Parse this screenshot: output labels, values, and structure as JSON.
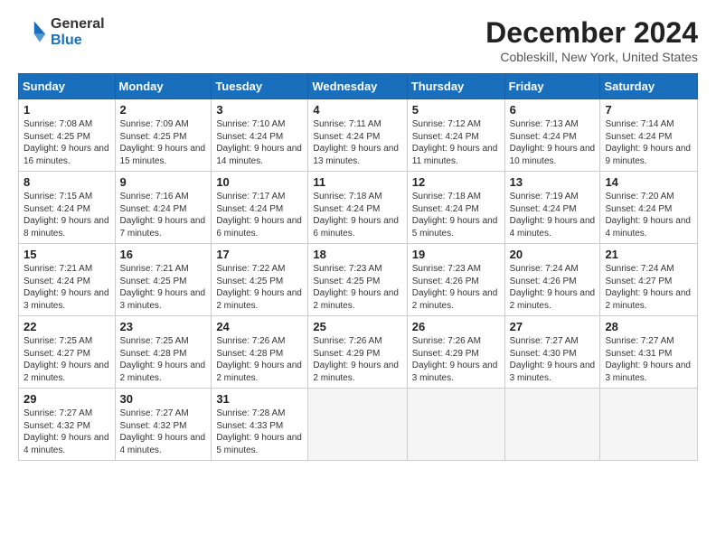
{
  "logo": {
    "general": "General",
    "blue": "Blue"
  },
  "title": "December 2024",
  "subtitle": "Cobleskill, New York, United States",
  "headers": [
    "Sunday",
    "Monday",
    "Tuesday",
    "Wednesday",
    "Thursday",
    "Friday",
    "Saturday"
  ],
  "weeks": [
    [
      {
        "day": "1",
        "sunrise": "Sunrise: 7:08 AM",
        "sunset": "Sunset: 4:25 PM",
        "daylight": "Daylight: 9 hours and 16 minutes."
      },
      {
        "day": "2",
        "sunrise": "Sunrise: 7:09 AM",
        "sunset": "Sunset: 4:25 PM",
        "daylight": "Daylight: 9 hours and 15 minutes."
      },
      {
        "day": "3",
        "sunrise": "Sunrise: 7:10 AM",
        "sunset": "Sunset: 4:24 PM",
        "daylight": "Daylight: 9 hours and 14 minutes."
      },
      {
        "day": "4",
        "sunrise": "Sunrise: 7:11 AM",
        "sunset": "Sunset: 4:24 PM",
        "daylight": "Daylight: 9 hours and 13 minutes."
      },
      {
        "day": "5",
        "sunrise": "Sunrise: 7:12 AM",
        "sunset": "Sunset: 4:24 PM",
        "daylight": "Daylight: 9 hours and 11 minutes."
      },
      {
        "day": "6",
        "sunrise": "Sunrise: 7:13 AM",
        "sunset": "Sunset: 4:24 PM",
        "daylight": "Daylight: 9 hours and 10 minutes."
      },
      {
        "day": "7",
        "sunrise": "Sunrise: 7:14 AM",
        "sunset": "Sunset: 4:24 PM",
        "daylight": "Daylight: 9 hours and 9 minutes."
      }
    ],
    [
      {
        "day": "8",
        "sunrise": "Sunrise: 7:15 AM",
        "sunset": "Sunset: 4:24 PM",
        "daylight": "Daylight: 9 hours and 8 minutes."
      },
      {
        "day": "9",
        "sunrise": "Sunrise: 7:16 AM",
        "sunset": "Sunset: 4:24 PM",
        "daylight": "Daylight: 9 hours and 7 minutes."
      },
      {
        "day": "10",
        "sunrise": "Sunrise: 7:17 AM",
        "sunset": "Sunset: 4:24 PM",
        "daylight": "Daylight: 9 hours and 6 minutes."
      },
      {
        "day": "11",
        "sunrise": "Sunrise: 7:18 AM",
        "sunset": "Sunset: 4:24 PM",
        "daylight": "Daylight: 9 hours and 6 minutes."
      },
      {
        "day": "12",
        "sunrise": "Sunrise: 7:18 AM",
        "sunset": "Sunset: 4:24 PM",
        "daylight": "Daylight: 9 hours and 5 minutes."
      },
      {
        "day": "13",
        "sunrise": "Sunrise: 7:19 AM",
        "sunset": "Sunset: 4:24 PM",
        "daylight": "Daylight: 9 hours and 4 minutes."
      },
      {
        "day": "14",
        "sunrise": "Sunrise: 7:20 AM",
        "sunset": "Sunset: 4:24 PM",
        "daylight": "Daylight: 9 hours and 4 minutes."
      }
    ],
    [
      {
        "day": "15",
        "sunrise": "Sunrise: 7:21 AM",
        "sunset": "Sunset: 4:24 PM",
        "daylight": "Daylight: 9 hours and 3 minutes."
      },
      {
        "day": "16",
        "sunrise": "Sunrise: 7:21 AM",
        "sunset": "Sunset: 4:25 PM",
        "daylight": "Daylight: 9 hours and 3 minutes."
      },
      {
        "day": "17",
        "sunrise": "Sunrise: 7:22 AM",
        "sunset": "Sunset: 4:25 PM",
        "daylight": "Daylight: 9 hours and 2 minutes."
      },
      {
        "day": "18",
        "sunrise": "Sunrise: 7:23 AM",
        "sunset": "Sunset: 4:25 PM",
        "daylight": "Daylight: 9 hours and 2 minutes."
      },
      {
        "day": "19",
        "sunrise": "Sunrise: 7:23 AM",
        "sunset": "Sunset: 4:26 PM",
        "daylight": "Daylight: 9 hours and 2 minutes."
      },
      {
        "day": "20",
        "sunrise": "Sunrise: 7:24 AM",
        "sunset": "Sunset: 4:26 PM",
        "daylight": "Daylight: 9 hours and 2 minutes."
      },
      {
        "day": "21",
        "sunrise": "Sunrise: 7:24 AM",
        "sunset": "Sunset: 4:27 PM",
        "daylight": "Daylight: 9 hours and 2 minutes."
      }
    ],
    [
      {
        "day": "22",
        "sunrise": "Sunrise: 7:25 AM",
        "sunset": "Sunset: 4:27 PM",
        "daylight": "Daylight: 9 hours and 2 minutes."
      },
      {
        "day": "23",
        "sunrise": "Sunrise: 7:25 AM",
        "sunset": "Sunset: 4:28 PM",
        "daylight": "Daylight: 9 hours and 2 minutes."
      },
      {
        "day": "24",
        "sunrise": "Sunrise: 7:26 AM",
        "sunset": "Sunset: 4:28 PM",
        "daylight": "Daylight: 9 hours and 2 minutes."
      },
      {
        "day": "25",
        "sunrise": "Sunrise: 7:26 AM",
        "sunset": "Sunset: 4:29 PM",
        "daylight": "Daylight: 9 hours and 2 minutes."
      },
      {
        "day": "26",
        "sunrise": "Sunrise: 7:26 AM",
        "sunset": "Sunset: 4:29 PM",
        "daylight": "Daylight: 9 hours and 3 minutes."
      },
      {
        "day": "27",
        "sunrise": "Sunrise: 7:27 AM",
        "sunset": "Sunset: 4:30 PM",
        "daylight": "Daylight: 9 hours and 3 minutes."
      },
      {
        "day": "28",
        "sunrise": "Sunrise: 7:27 AM",
        "sunset": "Sunset: 4:31 PM",
        "daylight": "Daylight: 9 hours and 3 minutes."
      }
    ],
    [
      {
        "day": "29",
        "sunrise": "Sunrise: 7:27 AM",
        "sunset": "Sunset: 4:32 PM",
        "daylight": "Daylight: 9 hours and 4 minutes."
      },
      {
        "day": "30",
        "sunrise": "Sunrise: 7:27 AM",
        "sunset": "Sunset: 4:32 PM",
        "daylight": "Daylight: 9 hours and 4 minutes."
      },
      {
        "day": "31",
        "sunrise": "Sunrise: 7:28 AM",
        "sunset": "Sunset: 4:33 PM",
        "daylight": "Daylight: 9 hours and 5 minutes."
      },
      null,
      null,
      null,
      null
    ]
  ]
}
